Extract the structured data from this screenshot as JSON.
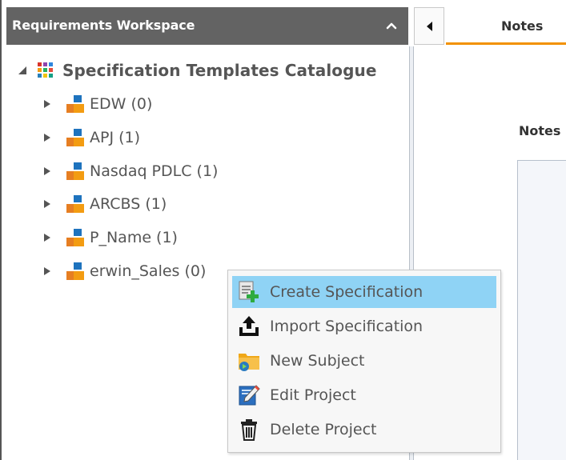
{
  "workspace": {
    "title": "Requirements Workspace",
    "tree": {
      "root_label": "Specification Templates Catalogue",
      "items": [
        {
          "label": "EDW (0)"
        },
        {
          "label": "APJ (1)"
        },
        {
          "label": "Nasdaq PDLC (1)"
        },
        {
          "label": "ARCBS (1)"
        },
        {
          "label": "P_Name (1)"
        },
        {
          "label": "erwin_Sales (0)"
        }
      ]
    }
  },
  "right_panel": {
    "tab_label": "Notes",
    "notes_heading": "Notes"
  },
  "context_menu": {
    "items": [
      {
        "label": "Create Specification",
        "icon": "create-specification-icon",
        "highlighted": true
      },
      {
        "label": "Import Specification",
        "icon": "import-icon"
      },
      {
        "label": "New Subject",
        "icon": "new-subject-icon"
      },
      {
        "label": "Edit Project",
        "icon": "edit-icon"
      },
      {
        "label": "Delete Project",
        "icon": "trash-icon"
      }
    ]
  },
  "colors": {
    "header_bg": "#636363",
    "tab_accent": "#f29100",
    "menu_highlight": "#8fd3f5"
  }
}
